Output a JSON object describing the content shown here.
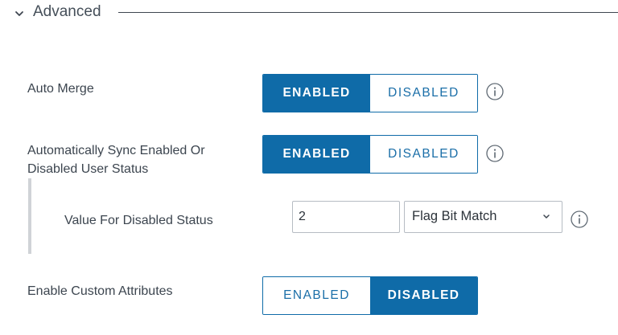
{
  "section": {
    "title": "Advanced",
    "expanded": true,
    "chevron_icon": "chevron-down-icon"
  },
  "colors": {
    "accent": "#0f6ba8",
    "text": "#3c454f",
    "border": "#b6bcc3",
    "nest_bar": "#d0d3d7"
  },
  "rows": {
    "auto_merge": {
      "label": "Auto Merge",
      "enabled_label": "ENABLED",
      "disabled_label": "DISABLED",
      "selected": "ENABLED",
      "info_icon": "info-icon"
    },
    "sync_status": {
      "label_line1": "Automatically Sync Enabled Or",
      "label_line2": "Disabled User Status",
      "enabled_label": "ENABLED",
      "disabled_label": "DISABLED",
      "selected": "ENABLED",
      "info_icon": "info-icon"
    },
    "disabled_status_value": {
      "label": "Value For Disabled Status",
      "input_value": "2",
      "select_value": "Flag Bit Match",
      "info_icon": "info-icon"
    },
    "custom_attributes": {
      "label": "Enable Custom Attributes",
      "enabled_label": "ENABLED",
      "disabled_label": "DISABLED",
      "selected": "DISABLED"
    }
  }
}
